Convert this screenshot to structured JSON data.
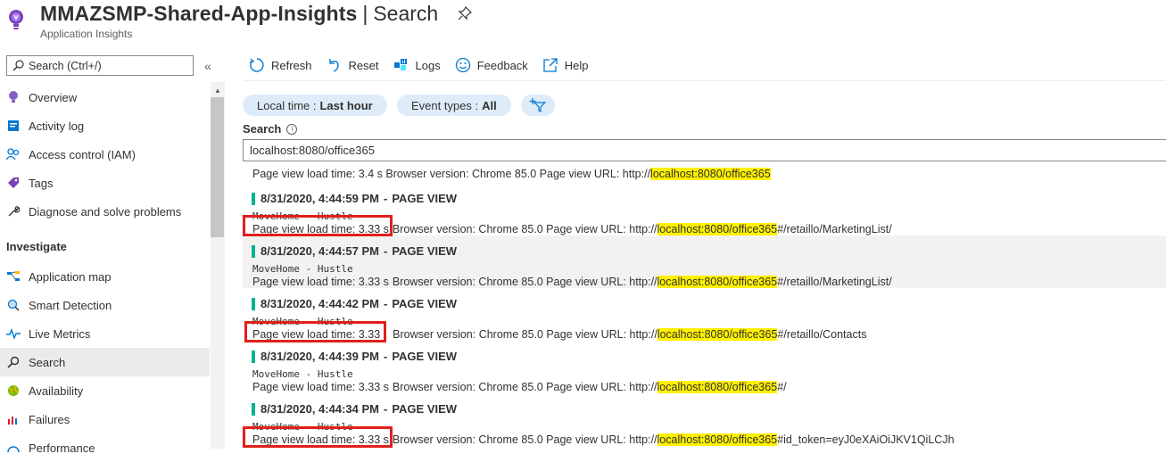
{
  "header": {
    "title": "MMAZSMP-Shared-App-Insights",
    "separator": "|",
    "page": "Search",
    "subtitle": "Application Insights"
  },
  "sidebar": {
    "search_placeholder": "Search (Ctrl+/)",
    "collapse_glyph": "«",
    "items_top": [
      {
        "label": "Overview",
        "icon": "lightbulb-icon"
      },
      {
        "label": "Activity log",
        "icon": "activity-log-icon"
      },
      {
        "label": "Access control (IAM)",
        "icon": "people-icon"
      },
      {
        "label": "Tags",
        "icon": "tag-icon"
      },
      {
        "label": "Diagnose and solve problems",
        "icon": "wrench-icon"
      }
    ],
    "section": "Investigate",
    "items_investigate": [
      {
        "label": "Application map",
        "icon": "app-map-icon"
      },
      {
        "label": "Smart Detection",
        "icon": "smart-detection-icon"
      },
      {
        "label": "Live Metrics",
        "icon": "pulse-icon"
      },
      {
        "label": "Search",
        "icon": "search-icon",
        "active": true
      },
      {
        "label": "Availability",
        "icon": "globe-icon"
      },
      {
        "label": "Failures",
        "icon": "failures-icon"
      },
      {
        "label": "Performance",
        "icon": "performance-icon"
      }
    ]
  },
  "toolbar": {
    "refresh": "Refresh",
    "reset": "Reset",
    "logs": "Logs",
    "feedback": "Feedback",
    "help": "Help"
  },
  "filters": {
    "time_label": "Local time :",
    "time_value": "Last hour",
    "events_label": "Event types :",
    "events_value": "All"
  },
  "search": {
    "label": "Search",
    "info": "i",
    "query": "localhost:8080/office365"
  },
  "partial_result": {
    "text": "Page view load time: 3.4 s  Browser version: Chrome 85.0  Page view URL: http://",
    "highlight": "localhost:8080/office365"
  },
  "results": [
    {
      "timestamp": "8/31/2020, 4:44:59 PM",
      "sep": "-",
      "type": "PAGE VIEW",
      "sub": "MoveHome - Hustle",
      "load": "Page view load time: 3.33 s",
      "browser": "Browser version: Chrome 85.0  Page view URL: http://",
      "highlight": "localhost:8080/office365",
      "rest": "#/retaillo/MarketingList/"
    },
    {
      "timestamp": "8/31/2020, 4:44:57 PM",
      "sep": "-",
      "type": "PAGE VIEW",
      "sub": "MoveHome - Hustle",
      "load": "Page view load time: 3.33 s",
      "browser": "Browser version: Chrome 85.0  Page view URL: http://",
      "highlight": "localhost:8080/office365",
      "rest": "#/retaillo/MarketingList/"
    },
    {
      "timestamp": "8/31/2020, 4:44:42 PM",
      "sep": "-",
      "type": "PAGE VIEW",
      "sub": "MoveHome - Hustle",
      "load": "Page view load time: 3.33",
      "browser": "Browser version: Chrome 85.0  Page view URL: http://",
      "highlight": "localhost:8080/office365",
      "rest": "#/retaillo/Contacts"
    },
    {
      "timestamp": "8/31/2020, 4:44:39 PM",
      "sep": "-",
      "type": "PAGE VIEW",
      "sub": "MoveHome - Hustle",
      "load": "Page view load time: 3.33 s",
      "browser": "Browser version: Chrome 85.0  Page view URL: http://",
      "highlight": "localhost:8080/office365",
      "rest": "#/"
    },
    {
      "timestamp": "8/31/2020, 4:44:34 PM",
      "sep": "-",
      "type": "PAGE VIEW",
      "sub": "MoveHome - Hustle",
      "load": "Page view load time: 3.33 s",
      "browser": "Browser version: Chrome 85.0  Page view URL: http://",
      "highlight": "localhost:8080/office365",
      "rest": "#id_token=eyJ0eXAiOiJKV1QiLCJh"
    }
  ],
  "colors": {
    "accent": "#0078d4",
    "pill_bg": "#deecf9",
    "highlight": "#fff100",
    "annotation_red": "#e0201b",
    "event_bar": "#00b294"
  }
}
